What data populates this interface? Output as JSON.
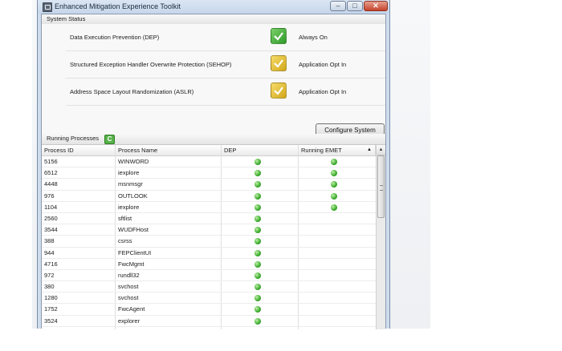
{
  "window": {
    "title": "Enhanced Mitigation Experience Toolkit",
    "controls": {
      "minimize": "‒",
      "maximize": "□",
      "close": "✕"
    }
  },
  "system_status": {
    "header": "System Status",
    "rows": [
      {
        "name": "Data Execution Prevention (DEP)",
        "value": "Always On",
        "state": "green"
      },
      {
        "name": "Structured Exception Handler Overwrite Protection (SEHOP)",
        "value": "Application Opt In",
        "state": "yellow"
      },
      {
        "name": "Address Space Layout Randomization (ASLR)",
        "value": "Application Opt In",
        "state": "yellow"
      }
    ],
    "configure_button": "Configure System"
  },
  "processes": {
    "header": "Running Processes",
    "columns": [
      "Process ID",
      "Process Name",
      "DEP",
      "Running EMET"
    ],
    "rows": [
      {
        "pid": "5156",
        "name": "WINWORD",
        "dep": true,
        "emet": true
      },
      {
        "pid": "6512",
        "name": "iexplore",
        "dep": true,
        "emet": true
      },
      {
        "pid": "4448",
        "name": "msnmsgr",
        "dep": true,
        "emet": true
      },
      {
        "pid": "976",
        "name": "OUTLOOK",
        "dep": true,
        "emet": true
      },
      {
        "pid": "1104",
        "name": "iexplore",
        "dep": true,
        "emet": true
      },
      {
        "pid": "2560",
        "name": "sftlist",
        "dep": true,
        "emet": false
      },
      {
        "pid": "3544",
        "name": "WUDFHost",
        "dep": true,
        "emet": false
      },
      {
        "pid": "388",
        "name": "csrss",
        "dep": true,
        "emet": false
      },
      {
        "pid": "944",
        "name": "FEPClientUI",
        "dep": true,
        "emet": false
      },
      {
        "pid": "4716",
        "name": "FwcMgmt",
        "dep": true,
        "emet": false
      },
      {
        "pid": "972",
        "name": "rundll32",
        "dep": true,
        "emet": false
      },
      {
        "pid": "380",
        "name": "svchost",
        "dep": true,
        "emet": false
      },
      {
        "pid": "1280",
        "name": "svchost",
        "dep": true,
        "emet": false
      },
      {
        "pid": "1752",
        "name": "FwcAgent",
        "dep": true,
        "emet": false
      },
      {
        "pid": "3524",
        "name": "explorer",
        "dep": true,
        "emet": false
      }
    ]
  },
  "colors": {
    "enabled": "#3aaa2c",
    "opt_in": "#d2a718"
  }
}
